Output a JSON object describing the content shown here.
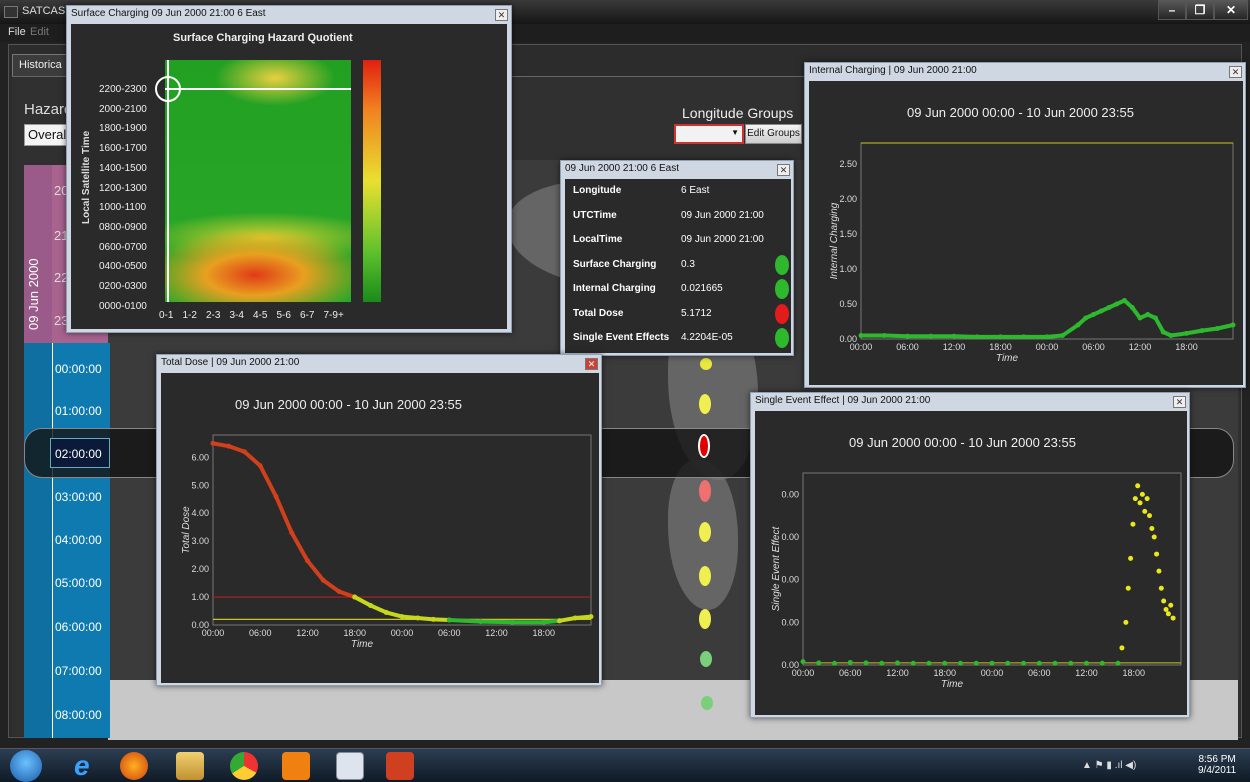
{
  "app": {
    "title": "SATCAST"
  },
  "menu": {
    "file": "File",
    "edit": "Edit"
  },
  "tabs": {
    "historical": "Historica"
  },
  "left": {
    "hazard_label": "Hazard",
    "overall_value": "Overal"
  },
  "longitude": {
    "heading": "Longitude Groups",
    "select_value": "",
    "edit_button": "Edit Groups"
  },
  "timeline": {
    "date": "09 Jun 2000",
    "date_hours": [
      "20",
      "21",
      "22",
      "23"
    ],
    "times": [
      "00:00:00",
      "01:00:00",
      "02:00:00",
      "03:00:00",
      "04:00:00",
      "05:00:00",
      "06:00:00",
      "07:00:00",
      "08:00:00"
    ]
  },
  "surface_window": {
    "title": "Surface Charging 09 Jun 2000 21:00 6 East",
    "chart_title": "Surface Charging Hazard Quotient",
    "ylabel": "Local Satellite Time",
    "yticks": [
      "2200-2300",
      "2000-2100",
      "1800-1900",
      "1600-1700",
      "1400-1500",
      "1200-1300",
      "1000-1100",
      "0800-0900",
      "0600-0700",
      "0400-0500",
      "0200-0300",
      "0000-0100"
    ],
    "xticks": [
      "0-1",
      "1-2",
      "2-3",
      "3-4",
      "4-5",
      "5-6",
      "6-7",
      "7-9+"
    ]
  },
  "info_window": {
    "title": "09 Jun 2000 21:00 6 East",
    "rows": [
      {
        "label": "Longitude",
        "value": "6 East",
        "status": ""
      },
      {
        "label": "UTCTime",
        "value": "09 Jun 2000 21:00",
        "status": ""
      },
      {
        "label": "LocalTime",
        "value": "09 Jun 2000 21:00",
        "status": ""
      },
      {
        "label": "Surface Charging",
        "value": "0.3",
        "status": "#2db82d"
      },
      {
        "label": "Internal Charging",
        "value": "0.021665",
        "status": "#2db82d"
      },
      {
        "label": "Total Dose",
        "value": "5.1712",
        "status": "#e31b1b"
      },
      {
        "label": "Single Event Effects",
        "value": "4.2204E-05",
        "status": "#2db82d"
      }
    ]
  },
  "internal_window": {
    "title": "Internal Charging | 09 Jun 2000 21:00",
    "range": "09 Jun 2000 00:00  -  10 Jun 2000 23:55"
  },
  "dose_window": {
    "title": "Total Dose | 09 Jun 2000 21:00",
    "range": "09 Jun 2000 00:00  -  10 Jun 2000 23:55"
  },
  "see_window": {
    "title": "Single Event Effect | 09 Jun 2000 21:00",
    "range": "09 Jun 2000 00:00  -  10 Jun 2000 23:55"
  },
  "taskbar": {
    "time": "8:56 PM",
    "date": "9/4/2011"
  },
  "chart_data": [
    {
      "type": "line",
      "id": "internal",
      "xlabel": "Time",
      "ylabel": "Internal Charging",
      "xticks": [
        "00:00",
        "06:00",
        "12:00",
        "18:00",
        "00:00",
        "06:00",
        "12:00",
        "18:00"
      ],
      "yticks": [
        0.0,
        0.5,
        1.0,
        1.5,
        2.0,
        2.5
      ],
      "ytick_labels": [
        "0.00",
        "0.50",
        "1.00",
        "1.50",
        "2.00",
        "2.50"
      ],
      "ylim": [
        0,
        2.8
      ],
      "xlim": [
        0,
        48
      ],
      "threshold": 2.8,
      "series": [
        {
          "color": "#2db82d",
          "x": [
            0,
            3,
            6,
            9,
            12,
            15,
            18,
            21,
            24,
            26,
            28,
            29,
            30,
            31,
            32,
            33,
            34,
            35,
            36,
            37,
            38,
            39,
            40,
            42,
            44,
            46,
            48
          ],
          "y": [
            0.05,
            0.05,
            0.04,
            0.04,
            0.04,
            0.03,
            0.03,
            0.03,
            0.03,
            0.05,
            0.2,
            0.3,
            0.35,
            0.4,
            0.45,
            0.5,
            0.55,
            0.45,
            0.3,
            0.35,
            0.3,
            0.1,
            0.05,
            0.08,
            0.12,
            0.15,
            0.2
          ]
        }
      ]
    },
    {
      "type": "line",
      "id": "dose",
      "xlabel": "Time",
      "ylabel": "Total Dose",
      "xticks": [
        "00:00",
        "06:00",
        "12:00",
        "18:00",
        "00:00",
        "06:00",
        "12:00",
        "18:00"
      ],
      "yticks": [
        0,
        1,
        2,
        3,
        4,
        5,
        6
      ],
      "ytick_labels": [
        "0.00",
        "1.00",
        "2.00",
        "3.00",
        "4.00",
        "5.00",
        "6.00"
      ],
      "ylim": [
        0,
        6.8
      ],
      "xlim": [
        0,
        48
      ],
      "thresholds": [
        {
          "value": 1.0,
          "color": "#b02020"
        },
        {
          "value": 0.2,
          "color": "#c8c820"
        }
      ],
      "series": [
        {
          "color": "#d0401c",
          "x": [
            0,
            2,
            4,
            6,
            8,
            10,
            12,
            14,
            16,
            18
          ],
          "y": [
            6.5,
            6.4,
            6.2,
            5.7,
            4.6,
            3.3,
            2.3,
            1.6,
            1.2,
            1.0
          ]
        },
        {
          "color": "#c6d81e",
          "x": [
            18,
            20,
            22,
            24,
            26,
            28,
            30
          ],
          "y": [
            1.0,
            0.7,
            0.45,
            0.3,
            0.25,
            0.2,
            0.18
          ]
        },
        {
          "color": "#2db82d",
          "x": [
            30,
            34,
            38,
            42,
            44
          ],
          "y": [
            0.18,
            0.12,
            0.1,
            0.1,
            0.15
          ]
        },
        {
          "color": "#c6d81e",
          "x": [
            44,
            46,
            48
          ],
          "y": [
            0.15,
            0.25,
            0.3
          ]
        }
      ]
    },
    {
      "type": "scatter",
      "id": "see",
      "xlabel": "Time",
      "ylabel": "Single Event Effect",
      "xticks": [
        "00:00",
        "06:00",
        "12:00",
        "18:00",
        "00:00",
        "06:00",
        "12:00",
        "18:00"
      ],
      "yticks": [
        0,
        1,
        2,
        3,
        4
      ],
      "ytick_labels": [
        "0.00",
        "0.00",
        "0.00",
        "0.00",
        "0.00"
      ],
      "ylim": [
        0,
        4.5
      ],
      "xlim": [
        0,
        48
      ],
      "threshold": 0.05,
      "series": [
        {
          "color": "#2db82d",
          "x": [
            0,
            2,
            4,
            6,
            8,
            10,
            12,
            14,
            16,
            18,
            20,
            22,
            24,
            26,
            28,
            30,
            32,
            34,
            36,
            38,
            40
          ],
          "y": [
            0.08,
            0.05,
            0.04,
            0.06,
            0.05,
            0.04,
            0.05,
            0.04,
            0.04,
            0.04,
            0.04,
            0.04,
            0.04,
            0.04,
            0.04,
            0.04,
            0.04,
            0.04,
            0.04,
            0.04,
            0.04
          ]
        },
        {
          "color": "#e8e81a",
          "x": [
            40.5,
            41,
            41.3,
            41.6,
            41.9,
            42.2,
            42.5,
            42.8,
            43.1,
            43.4,
            43.7,
            44,
            44.3,
            44.6,
            44.9,
            45.2,
            45.5,
            45.8,
            46.1,
            46.4,
            46.7,
            47
          ],
          "y": [
            0.4,
            1.0,
            1.8,
            2.5,
            3.3,
            3.9,
            4.2,
            3.8,
            4.0,
            3.6,
            3.9,
            3.5,
            3.2,
            3.0,
            2.6,
            2.2,
            1.8,
            1.5,
            1.3,
            1.2,
            1.4,
            1.1
          ]
        }
      ]
    }
  ]
}
